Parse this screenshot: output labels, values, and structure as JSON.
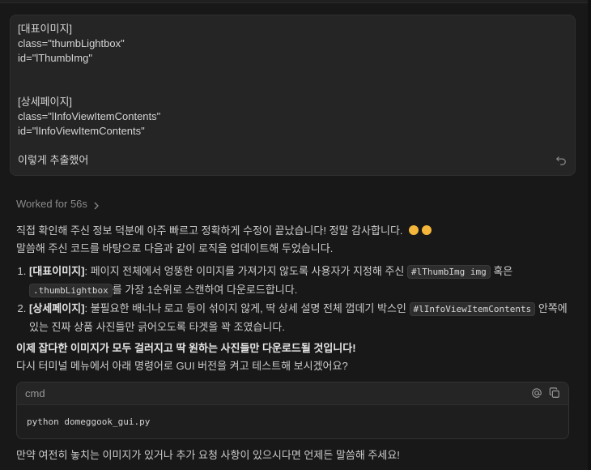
{
  "user_message": {
    "lines": [
      "[대표이미지]",
      "class=\"thumbLightbox\"",
      "id=\"lThumbImg\"",
      "",
      "",
      "[상세페이지]",
      "class=\"lInfoViewItemContents\"",
      "id=\"lInfoViewItemContents\"",
      "",
      "이렇게 추출했어"
    ]
  },
  "worked": {
    "label": "Worked for 56s"
  },
  "response": {
    "intro1": "직접 확인해 주신 정보 덕분에 아주 빠르고 정확하게 수정이 끝났습니다! 정말 감사합니다.",
    "intro2": "말씀해 주신 코드를 바탕으로 다음과 같이 로직을 업데이트해 두었습니다.",
    "items": [
      {
        "title": "[대표이미지]",
        "t1": ": 페이지 전체에서 엉뚱한 이미지를 가져가지 않도록 사용자가 지정해 주신 ",
        "code1": "#lThumbImg img",
        "t2": " 혹은",
        "code2": ".thumbLightbox",
        "t3": "를 가장 1순위로 스캔하여 다운로드합니다."
      },
      {
        "title": "[상세페이지]",
        "t1": ": 불필요한 배너나 로고 등이 섞이지 않게, 딱 상세 설명 전체 껍데기 박스인 ",
        "code1": "#lInfoViewItemContents",
        "t2": " 안쪽에",
        "t3": "있는 진짜 상품 사진들만 긁어오도록 타겟을 꽉 조였습니다."
      }
    ],
    "bold_line": "이제 잡다한 이미지가 모두 걸러지고 딱 원하는 사진들만 다운로드될 것입니다!",
    "after_bold": "다시 터미널 메뉴에서 아래 명령어로 GUI 버전을 켜고 테스트해 보시겠어요?"
  },
  "codeblock": {
    "lang": "cmd",
    "code": "python domeggook_gui.py"
  },
  "closing": "만약 여전히 놓치는 이미지가 있거나 추가 요청 사항이 있으시다면 언제든 말씀해 주세요!",
  "icons": {
    "undo": "undo-icon",
    "chevron": "chevron-right-icon",
    "mention": "at-icon",
    "copy": "copy-icon",
    "clap": "clap-emoji"
  },
  "colors": {
    "background": "#181818",
    "panel": "#252526",
    "text": "#cccccc",
    "muted": "#8b8b8b",
    "emoji": "#f3b63a"
  }
}
